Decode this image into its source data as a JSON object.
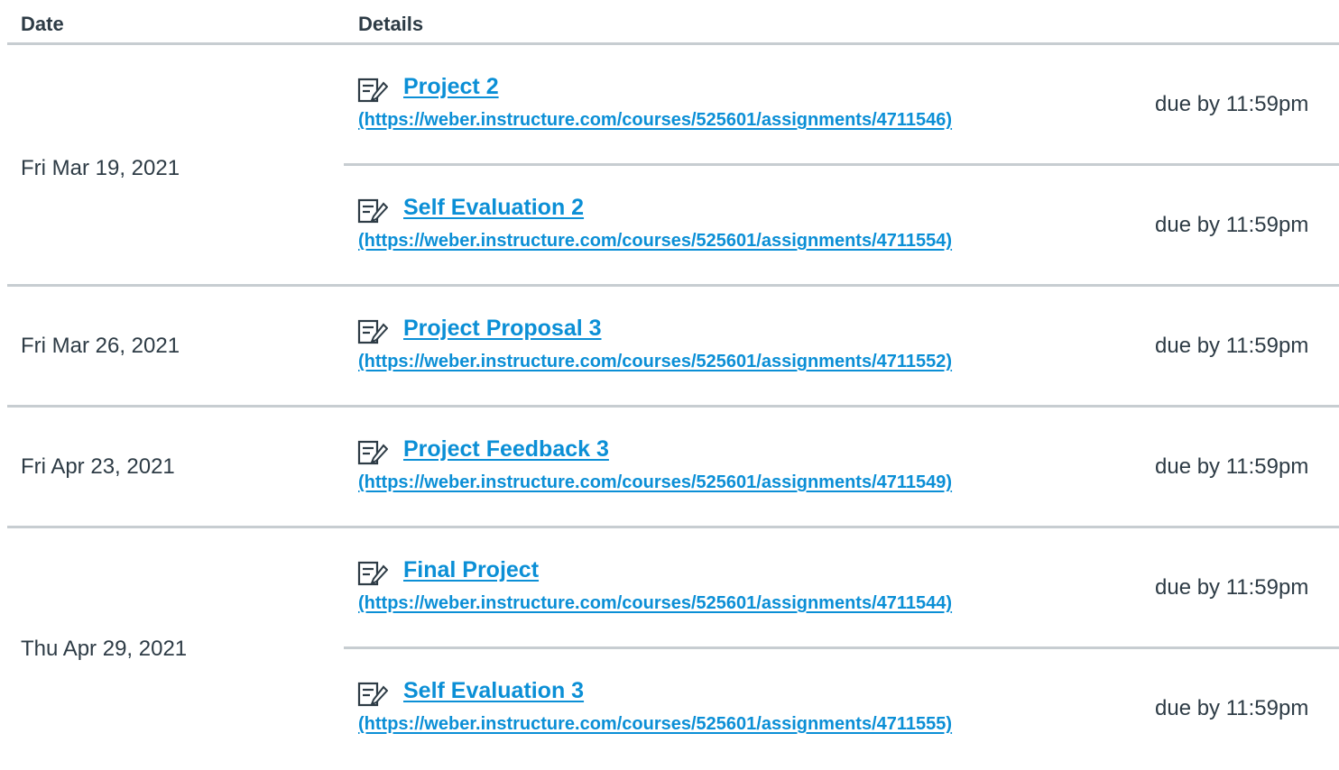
{
  "header": {
    "date_label": "Date",
    "details_label": "Details"
  },
  "groups": [
    {
      "date": "Fri Mar 19, 2021",
      "items": [
        {
          "title": "Project 2",
          "url": "(https://weber.instructure.com/courses/525601/assignments/4711546)",
          "due": "due by 11:59pm",
          "icon": "assignment-icon"
        },
        {
          "title": "Self Evaluation 2",
          "url": "(https://weber.instructure.com/courses/525601/assignments/4711554)",
          "due": "due by 11:59pm",
          "icon": "assignment-icon"
        }
      ]
    },
    {
      "date": "Fri Mar 26, 2021",
      "items": [
        {
          "title": "Project Proposal 3",
          "url": "(https://weber.instructure.com/courses/525601/assignments/4711552)",
          "due": "due by 11:59pm",
          "icon": "assignment-icon"
        }
      ]
    },
    {
      "date": "Fri Apr 23, 2021",
      "items": [
        {
          "title": "Project Feedback 3",
          "url": "(https://weber.instructure.com/courses/525601/assignments/4711549)",
          "due": "due by 11:59pm",
          "icon": "assignment-icon"
        }
      ]
    },
    {
      "date": "Thu Apr 29, 2021",
      "items": [
        {
          "title": "Final Project",
          "url": "(https://weber.instructure.com/courses/525601/assignments/4711544)",
          "due": "due by 11:59pm",
          "icon": "assignment-icon"
        },
        {
          "title": "Self Evaluation 3",
          "url": "(https://weber.instructure.com/courses/525601/assignments/4711555)",
          "due": "due by 11:59pm",
          "icon": "assignment-icon"
        }
      ]
    }
  ],
  "colors": {
    "link": "#0b8fd6",
    "text": "#2d3b45",
    "divider": "#c7cdd1"
  }
}
